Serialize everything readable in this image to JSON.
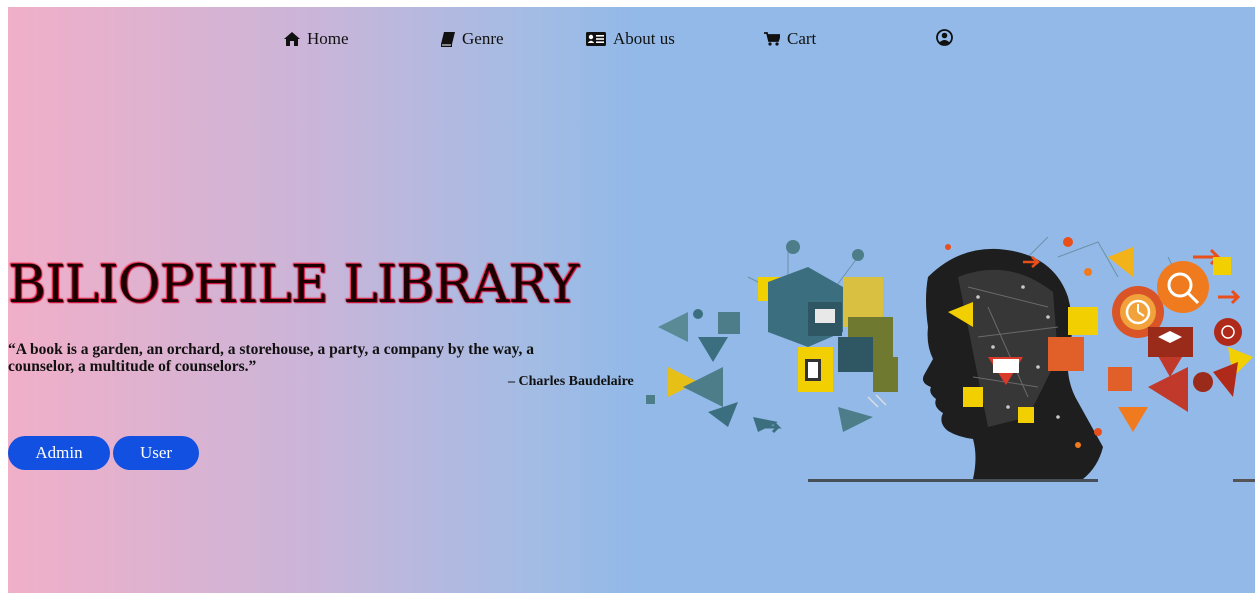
{
  "nav": {
    "items": [
      {
        "label": "Home",
        "icon": "home-icon"
      },
      {
        "label": "Genre",
        "icon": "book-icon"
      },
      {
        "label": "About us",
        "icon": "id-card-icon"
      },
      {
        "label": "Cart",
        "icon": "cart-icon"
      }
    ],
    "profile_icon": "user-circle-icon"
  },
  "hero": {
    "title": "BILIOPHILE LIBRARY",
    "quote": "“A book is a garden, an orchard, a storehouse, a party, a company by the way, a counselor, a multitude of counselors.”",
    "author": "– Charles Baudelaire"
  },
  "buttons": {
    "admin_label": "Admin",
    "user_label": "User"
  },
  "colors": {
    "gradient_left": "#f1afc8",
    "gradient_right": "#93b9e8",
    "button": "#1150e0",
    "title_glow": "#d3002a"
  }
}
